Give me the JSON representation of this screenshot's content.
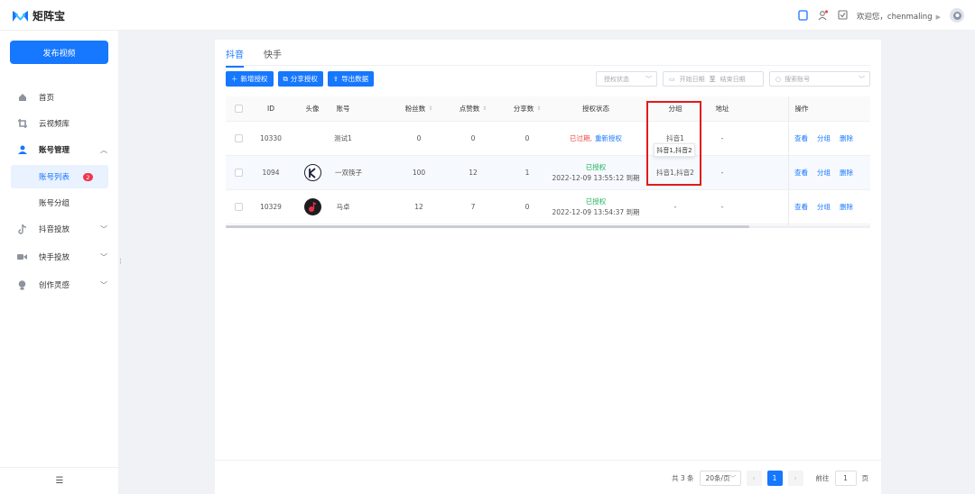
{
  "app": {
    "name": "矩阵宝"
  },
  "header": {
    "welcome": "欢迎您，chenmaling"
  },
  "sidebar": {
    "publish_label": "发布视频",
    "items": [
      {
        "label": "首页",
        "icon": "home-icon"
      },
      {
        "label": "云视频库",
        "icon": "crop-icon"
      },
      {
        "label": "账号管理",
        "icon": "user-icon",
        "expanded": true
      },
      {
        "label": "抖音投放",
        "icon": "tiktok-icon"
      },
      {
        "label": "快手投放",
        "icon": "kuaishou-icon"
      },
      {
        "label": "创作灵感",
        "icon": "bulb-icon"
      }
    ],
    "sub_items": [
      {
        "label": "账号列表",
        "badge": "2",
        "active": true
      },
      {
        "label": "账号分组"
      }
    ]
  },
  "tabs": [
    {
      "label": "抖音",
      "active": true
    },
    {
      "label": "快手"
    }
  ],
  "toolbar": {
    "add_label": "新增授权",
    "share_label": "分享授权",
    "export_label": "导出数据"
  },
  "filters": {
    "auth_status_placeholder": "授权状态",
    "start_date": "开始日期",
    "date_sep": "至",
    "end_date": "结束日期",
    "search_placeholder": "搜索账号"
  },
  "table": {
    "headers": {
      "id": "ID",
      "avatar": "头像",
      "account": "账号",
      "fans": "粉丝数",
      "likes": "点赞数",
      "shares": "分享数",
      "status": "授权状态",
      "group": "分组",
      "address": "地址",
      "ops": "操作"
    },
    "rows": [
      {
        "id": "10330",
        "account": "测试1",
        "fans": "0",
        "likes": "0",
        "shares": "0",
        "status": "已过期,",
        "status_action": "重新授权",
        "status_color": "#f04a4a",
        "expire": "",
        "group": "抖音1",
        "address": "-"
      },
      {
        "id": "1094",
        "account": "一双筷子",
        "fans": "100",
        "likes": "12",
        "shares": "1",
        "status": "已授权",
        "status_color": "#21b35e",
        "expire": "2022-12-09 13:55:12 到期",
        "group": "抖音1,抖音2",
        "address": "-"
      },
      {
        "id": "10329",
        "account": "马卓",
        "fans": "12",
        "likes": "7",
        "shares": "0",
        "status": "已授权",
        "status_color": "#21b35e",
        "expire": "2022-12-09 13:54:37 到期",
        "group": "-",
        "address": "-"
      }
    ],
    "ops": {
      "view": "查看",
      "group": "分组",
      "delete": "删除"
    },
    "tooltip": "抖音1,抖音2"
  },
  "pager": {
    "total": "共 3 条",
    "page_size": "20条/页",
    "current": "1",
    "goto_label": "前往",
    "goto_value": "1",
    "page_unit": "页"
  },
  "colors": {
    "primary": "#1677ff",
    "highlight_box": "#e01b1b",
    "badge": "#f0364f"
  }
}
